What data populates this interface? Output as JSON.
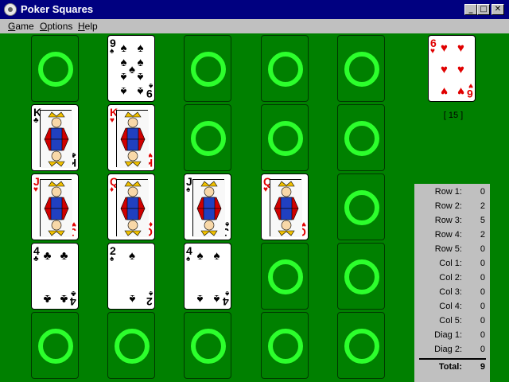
{
  "window": {
    "title": "Poker Squares",
    "buttons": {
      "minimize": "_",
      "maximize": "□",
      "close": "✕"
    },
    "icon": "app-icon"
  },
  "menu": {
    "game": "Game",
    "options": "Options",
    "help": "Help"
  },
  "colors": {
    "felt": "#008000",
    "ring": "#2cff2c",
    "red_suit": "#e00000",
    "panel": "#c0c0c0"
  },
  "grid": [
    [
      {
        "empty": true
      },
      {
        "rank": "9",
        "suit": "♠",
        "color": "black",
        "pips": 9
      },
      {
        "empty": true
      },
      {
        "empty": true
      },
      {
        "empty": true
      }
    ],
    [
      {
        "rank": "K",
        "suit": "♣",
        "color": "black",
        "face": true
      },
      {
        "rank": "K",
        "suit": "♥",
        "color": "red",
        "face": true
      },
      {
        "empty": true
      },
      {
        "empty": true
      },
      {
        "empty": true
      }
    ],
    [
      {
        "rank": "J",
        "suit": "♥",
        "color": "red",
        "face": true
      },
      {
        "rank": "Q",
        "suit": "♦",
        "color": "red",
        "face": true
      },
      {
        "rank": "J",
        "suit": "♠",
        "color": "black",
        "face": true
      },
      {
        "rank": "Q",
        "suit": "♥",
        "color": "red",
        "face": true
      },
      {
        "empty": true
      }
    ],
    [
      {
        "rank": "4",
        "suit": "♣",
        "color": "black",
        "pips": 4
      },
      {
        "rank": "2",
        "suit": "♠",
        "color": "black",
        "pips": 2
      },
      {
        "rank": "4",
        "suit": "♠",
        "color": "black",
        "pips": 4
      },
      {
        "empty": true
      },
      {
        "empty": true
      }
    ],
    [
      {
        "empty": true
      },
      {
        "empty": true
      },
      {
        "empty": true
      },
      {
        "empty": true
      },
      {
        "empty": true
      }
    ]
  ],
  "next_card": {
    "rank": "6",
    "suit": "♥",
    "color": "red",
    "pips": 6
  },
  "cards_remaining": "[ 15 ]",
  "scores": [
    {
      "label": "Row 1:",
      "value": "0"
    },
    {
      "label": "Row 2:",
      "value": "2"
    },
    {
      "label": "Row 3:",
      "value": "5"
    },
    {
      "label": "Row 4:",
      "value": "2"
    },
    {
      "label": "Row 5:",
      "value": "0"
    },
    {
      "label": "Col 1:",
      "value": "0"
    },
    {
      "label": "Col 2:",
      "value": "0"
    },
    {
      "label": "Col 3:",
      "value": "0"
    },
    {
      "label": "Col 4:",
      "value": "0"
    },
    {
      "label": "Col 5:",
      "value": "0"
    },
    {
      "label": "Diag 1:",
      "value": "0"
    },
    {
      "label": "Diag 2:",
      "value": "0"
    }
  ],
  "total": {
    "label": "Total:",
    "value": "9"
  }
}
